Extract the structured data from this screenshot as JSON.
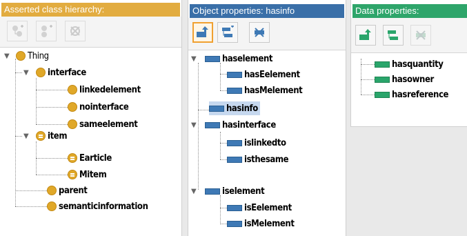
{
  "class_panel": {
    "title": "Asserted class hierarchy:",
    "toolbar": [
      "add-subclass-icon",
      "add-sibling-class-icon",
      "delete-class-icon"
    ],
    "tree": {
      "root": "Thing",
      "interface": "interface",
      "linkedelement": "linkedelement",
      "nointerface": "nointerface",
      "sameelement": "sameelement",
      "item": "item",
      "earticle": "Earticle",
      "mitem": "Mitem",
      "parent": "parent",
      "semanticinformation": "semanticinformation"
    }
  },
  "object_panel": {
    "title": "Object properties: hasinfo",
    "toolbar": [
      "add-subproperty-icon",
      "add-sibling-property-icon",
      "delete-property-icon"
    ],
    "tree": {
      "haselement": "haselement",
      "hasEelement": "hasEelement",
      "hasMelement": "hasMelement",
      "hasinfo": "hasinfo",
      "hasinterface": "hasinterface",
      "islinkedto": "islinkedto",
      "isthesame": "isthesame",
      "iselement": "iselement",
      "isEelement": "isEelement",
      "isMelement": "isMelement"
    },
    "selected": "hasinfo"
  },
  "data_panel": {
    "title": "Data properties:",
    "toolbar": [
      "add-subproperty-icon",
      "add-sibling-property-icon",
      "delete-property-icon"
    ],
    "tree": {
      "hasquantity": "hasquantity",
      "hasowner": "hasowner",
      "hasreference": "hasreference"
    }
  },
  "colors": {
    "class_header": "#e2ac40",
    "object_header": "#3a6fa8",
    "data_header": "#2ea56a",
    "class_icon": "#e0a829",
    "object_icon": "#3e79b5",
    "data_icon": "#2aa56b",
    "selection": "#c6d8ef"
  }
}
